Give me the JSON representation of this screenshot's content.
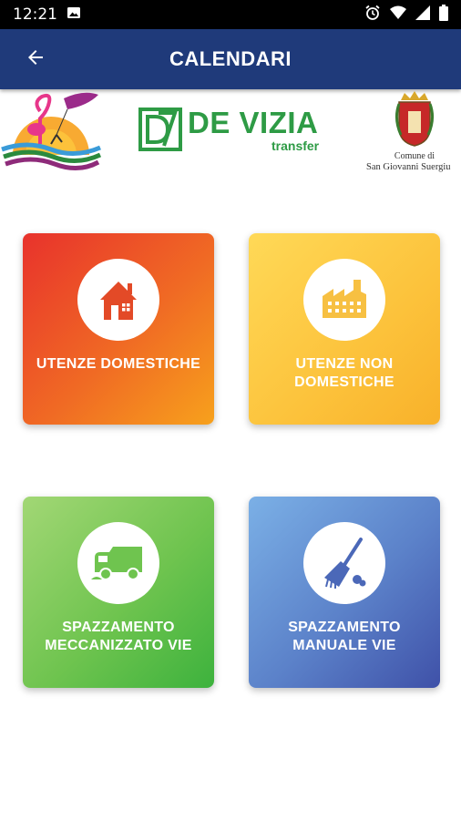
{
  "status_bar": {
    "time": "12:21"
  },
  "app_bar": {
    "title": "CALENDARI"
  },
  "logos": {
    "brand_name": "DE VIZIA",
    "brand_sub": "transfer",
    "comune_line1": "Comune di",
    "comune_line2": "San Giovanni Suergiu"
  },
  "cards": [
    {
      "label": "UTENZE DOMESTICHE",
      "icon": "house-icon"
    },
    {
      "label": "UTENZE NON DOMESTICHE",
      "icon": "factory-icon"
    },
    {
      "label": "SPAZZAMENTO MECCANIZZATO VIE",
      "icon": "truck-icon"
    },
    {
      "label": "SPAZZAMENTO MANUALE VIE",
      "icon": "broom-icon"
    }
  ],
  "colors": {
    "app_bar": "#1f3a7a",
    "card_domestiche": "#f06a24",
    "card_non_domestiche": "#fcc23b",
    "card_meccanizzato": "#6fc44f",
    "card_manuale": "#5b81c9"
  }
}
